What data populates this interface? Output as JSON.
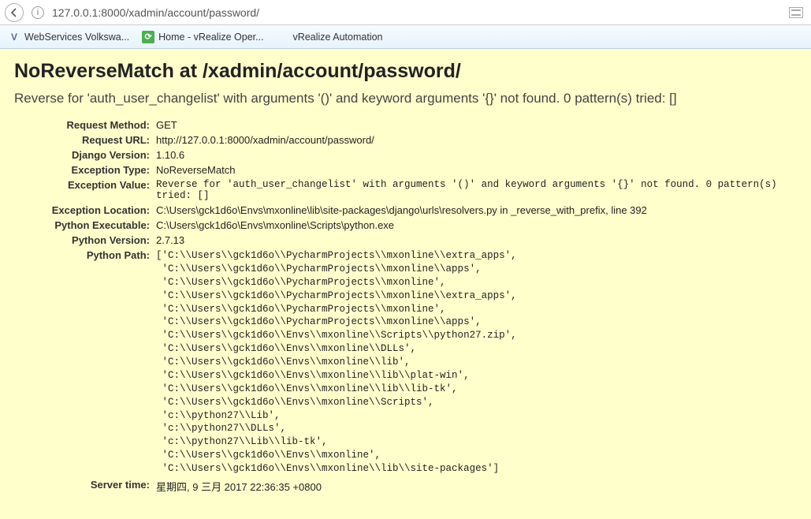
{
  "browser": {
    "url": "127.0.0.1:8000/xadmin/account/password/"
  },
  "bookmarks": [
    {
      "label": "WebServices Volkswa..."
    },
    {
      "label": "Home - vRealize Oper..."
    },
    {
      "label": "vRealize Automation"
    }
  ],
  "error": {
    "title": "NoReverseMatch at /xadmin/account/password/",
    "subtitle": "Reverse for 'auth_user_changelist' with arguments '()' and keyword arguments '{}' not found. 0 pattern(s) tried: []",
    "labels": {
      "request_method": "Request Method:",
      "request_url": "Request URL:",
      "django_version": "Django Version:",
      "exception_type": "Exception Type:",
      "exception_value": "Exception Value:",
      "exception_location": "Exception Location:",
      "python_executable": "Python Executable:",
      "python_version": "Python Version:",
      "python_path": "Python Path:",
      "server_time": "Server time:"
    },
    "values": {
      "request_method": "GET",
      "request_url": "http://127.0.0.1:8000/xadmin/account/password/",
      "django_version": "1.10.6",
      "exception_type": "NoReverseMatch",
      "exception_value": "Reverse for 'auth_user_changelist' with arguments '()' and keyword arguments '{}' not found. 0 pattern(s) tried: []",
      "exception_location": "C:\\Users\\gck1d6o\\Envs\\mxonline\\lib\\site-packages\\django\\urls\\resolvers.py in _reverse_with_prefix, line 392",
      "python_executable": "C:\\Users\\gck1d6o\\Envs\\mxonline\\Scripts\\python.exe",
      "python_version": "2.7.13",
      "python_path": "['C:\\\\Users\\\\gck1d6o\\\\PycharmProjects\\\\mxonline\\\\extra_apps',\n 'C:\\\\Users\\\\gck1d6o\\\\PycharmProjects\\\\mxonline\\\\apps',\n 'C:\\\\Users\\\\gck1d6o\\\\PycharmProjects\\\\mxonline',\n 'C:\\\\Users\\\\gck1d6o\\\\PycharmProjects\\\\mxonline\\\\extra_apps',\n 'C:\\\\Users\\\\gck1d6o\\\\PycharmProjects\\\\mxonline',\n 'C:\\\\Users\\\\gck1d6o\\\\PycharmProjects\\\\mxonline\\\\apps',\n 'C:\\\\Users\\\\gck1d6o\\\\Envs\\\\mxonline\\\\Scripts\\\\python27.zip',\n 'C:\\\\Users\\\\gck1d6o\\\\Envs\\\\mxonline\\\\DLLs',\n 'C:\\\\Users\\\\gck1d6o\\\\Envs\\\\mxonline\\\\lib',\n 'C:\\\\Users\\\\gck1d6o\\\\Envs\\\\mxonline\\\\lib\\\\plat-win',\n 'C:\\\\Users\\\\gck1d6o\\\\Envs\\\\mxonline\\\\lib\\\\lib-tk',\n 'C:\\\\Users\\\\gck1d6o\\\\Envs\\\\mxonline\\\\Scripts',\n 'c:\\\\python27\\\\Lib',\n 'c:\\\\python27\\\\DLLs',\n 'c:\\\\python27\\\\Lib\\\\lib-tk',\n 'C:\\\\Users\\\\gck1d6o\\\\Envs\\\\mxonline',\n 'C:\\\\Users\\\\gck1d6o\\\\Envs\\\\mxonline\\\\lib\\\\site-packages']",
      "server_time": "星期四, 9 三月 2017 22:36:35 +0800"
    }
  }
}
